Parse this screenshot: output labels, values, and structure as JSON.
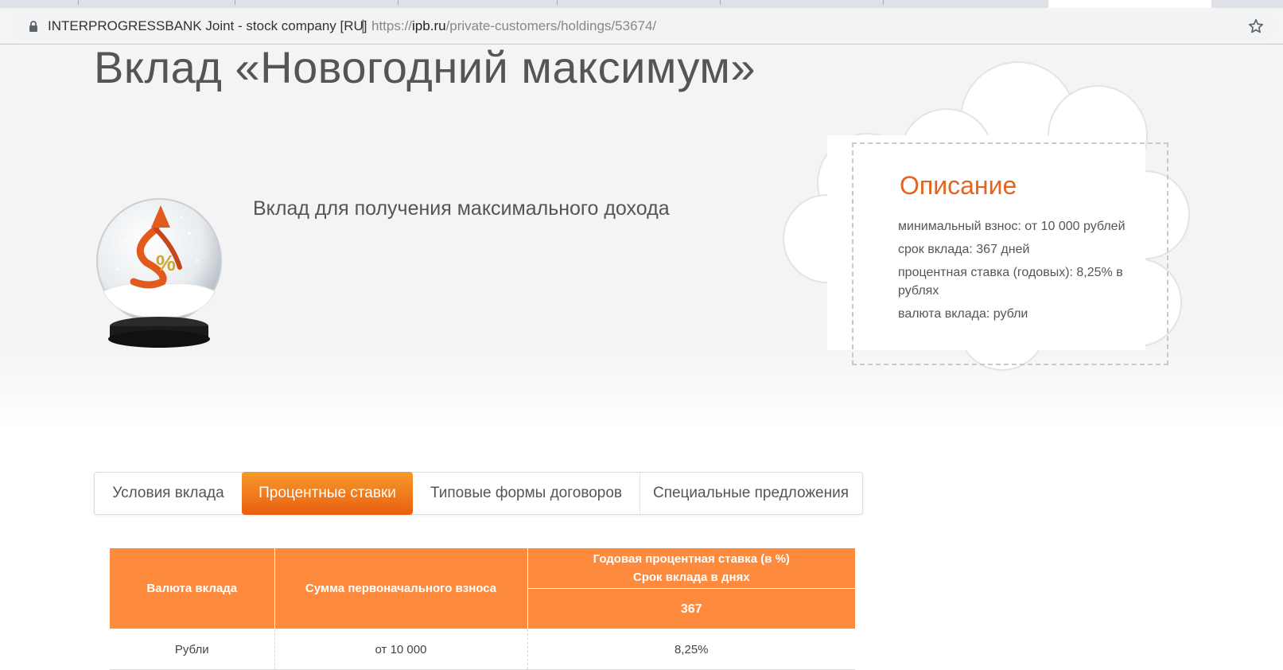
{
  "browser": {
    "site_name": "INTERPROGRESSBANK Joint - stock company [RU]",
    "separator": "|",
    "url_scheme": "https://",
    "url_host": "ipb.ru",
    "url_path": "/private-customers/holdings/53674/"
  },
  "page": {
    "title": "Вклад «Новогодний максимум»",
    "tagline": "Вклад для получения максимального дохода"
  },
  "description": {
    "title": "Описание",
    "items": [
      "минимальный взнос: от 10 000 рублей",
      "срок вклада: 367 дней",
      "процентная ставка (годовых): 8,25% в рублях",
      "валюта вклада: рубли"
    ]
  },
  "tabs": [
    {
      "label": "Условия вклада",
      "active": false
    },
    {
      "label": "Процентные ставки",
      "active": true
    },
    {
      "label": "Типовые формы договоров",
      "active": false
    },
    {
      "label": "Специальные предложения",
      "active": false
    }
  ],
  "rates_table": {
    "header_currency": "Валюта вклада",
    "header_amount": "Сумма первоначального взноса",
    "header_rate_line1": "Годовая процентная ставка (в %)",
    "header_rate_line2": "Срок вклада в днях",
    "term_days": "367",
    "rows": [
      {
        "currency": "Рубли",
        "amount": "от 10 000",
        "rate": "8,25%"
      }
    ]
  },
  "colors": {
    "accent_orange": "#e7621a",
    "table_header": "#fd8a3d",
    "active_tab": "#f07a1c"
  }
}
